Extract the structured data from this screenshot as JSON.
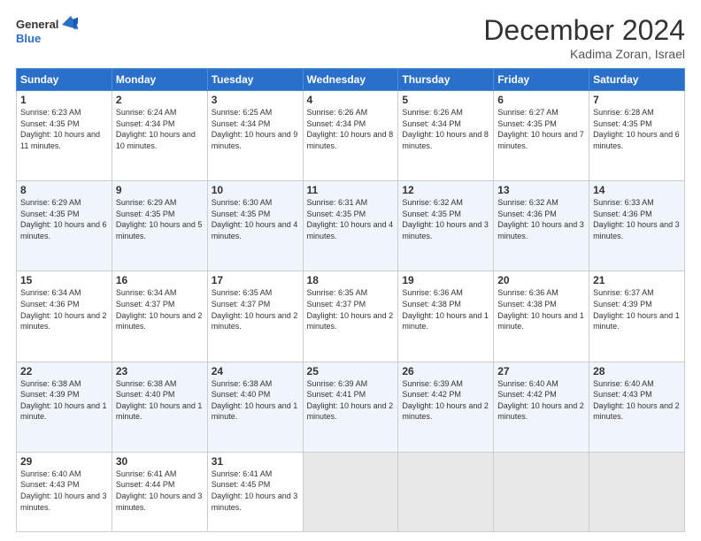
{
  "logo": {
    "general": "General",
    "blue": "Blue"
  },
  "title": "December 2024",
  "location": "Kadima Zoran, Israel",
  "header_days": [
    "Sunday",
    "Monday",
    "Tuesday",
    "Wednesday",
    "Thursday",
    "Friday",
    "Saturday"
  ],
  "weeks": [
    [
      {
        "day": "1",
        "info": "Sunrise: 6:23 AM\nSunset: 4:35 PM\nDaylight: 10 hours\nand 11 minutes."
      },
      {
        "day": "2",
        "info": "Sunrise: 6:24 AM\nSunset: 4:34 PM\nDaylight: 10 hours\nand 10 minutes."
      },
      {
        "day": "3",
        "info": "Sunrise: 6:25 AM\nSunset: 4:34 PM\nDaylight: 10 hours\nand 9 minutes."
      },
      {
        "day": "4",
        "info": "Sunrise: 6:26 AM\nSunset: 4:34 PM\nDaylight: 10 hours\nand 8 minutes."
      },
      {
        "day": "5",
        "info": "Sunrise: 6:26 AM\nSunset: 4:34 PM\nDaylight: 10 hours\nand 8 minutes."
      },
      {
        "day": "6",
        "info": "Sunrise: 6:27 AM\nSunset: 4:35 PM\nDaylight: 10 hours\nand 7 minutes."
      },
      {
        "day": "7",
        "info": "Sunrise: 6:28 AM\nSunset: 4:35 PM\nDaylight: 10 hours\nand 6 minutes."
      }
    ],
    [
      {
        "day": "8",
        "info": "Sunrise: 6:29 AM\nSunset: 4:35 PM\nDaylight: 10 hours\nand 6 minutes."
      },
      {
        "day": "9",
        "info": "Sunrise: 6:29 AM\nSunset: 4:35 PM\nDaylight: 10 hours\nand 5 minutes."
      },
      {
        "day": "10",
        "info": "Sunrise: 6:30 AM\nSunset: 4:35 PM\nDaylight: 10 hours\nand 4 minutes."
      },
      {
        "day": "11",
        "info": "Sunrise: 6:31 AM\nSunset: 4:35 PM\nDaylight: 10 hours\nand 4 minutes."
      },
      {
        "day": "12",
        "info": "Sunrise: 6:32 AM\nSunset: 4:35 PM\nDaylight: 10 hours\nand 3 minutes."
      },
      {
        "day": "13",
        "info": "Sunrise: 6:32 AM\nSunset: 4:36 PM\nDaylight: 10 hours\nand 3 minutes."
      },
      {
        "day": "14",
        "info": "Sunrise: 6:33 AM\nSunset: 4:36 PM\nDaylight: 10 hours\nand 3 minutes."
      }
    ],
    [
      {
        "day": "15",
        "info": "Sunrise: 6:34 AM\nSunset: 4:36 PM\nDaylight: 10 hours\nand 2 minutes."
      },
      {
        "day": "16",
        "info": "Sunrise: 6:34 AM\nSunset: 4:37 PM\nDaylight: 10 hours\nand 2 minutes."
      },
      {
        "day": "17",
        "info": "Sunrise: 6:35 AM\nSunset: 4:37 PM\nDaylight: 10 hours\nand 2 minutes."
      },
      {
        "day": "18",
        "info": "Sunrise: 6:35 AM\nSunset: 4:37 PM\nDaylight: 10 hours\nand 2 minutes."
      },
      {
        "day": "19",
        "info": "Sunrise: 6:36 AM\nSunset: 4:38 PM\nDaylight: 10 hours\nand 1 minute."
      },
      {
        "day": "20",
        "info": "Sunrise: 6:36 AM\nSunset: 4:38 PM\nDaylight: 10 hours\nand 1 minute."
      },
      {
        "day": "21",
        "info": "Sunrise: 6:37 AM\nSunset: 4:39 PM\nDaylight: 10 hours\nand 1 minute."
      }
    ],
    [
      {
        "day": "22",
        "info": "Sunrise: 6:38 AM\nSunset: 4:39 PM\nDaylight: 10 hours\nand 1 minute."
      },
      {
        "day": "23",
        "info": "Sunrise: 6:38 AM\nSunset: 4:40 PM\nDaylight: 10 hours\nand 1 minute."
      },
      {
        "day": "24",
        "info": "Sunrise: 6:38 AM\nSunset: 4:40 PM\nDaylight: 10 hours\nand 1 minute."
      },
      {
        "day": "25",
        "info": "Sunrise: 6:39 AM\nSunset: 4:41 PM\nDaylight: 10 hours\nand 2 minutes."
      },
      {
        "day": "26",
        "info": "Sunrise: 6:39 AM\nSunset: 4:42 PM\nDaylight: 10 hours\nand 2 minutes."
      },
      {
        "day": "27",
        "info": "Sunrise: 6:40 AM\nSunset: 4:42 PM\nDaylight: 10 hours\nand 2 minutes."
      },
      {
        "day": "28",
        "info": "Sunrise: 6:40 AM\nSunset: 4:43 PM\nDaylight: 10 hours\nand 2 minutes."
      }
    ],
    [
      {
        "day": "29",
        "info": "Sunrise: 6:40 AM\nSunset: 4:43 PM\nDaylight: 10 hours\nand 3 minutes."
      },
      {
        "day": "30",
        "info": "Sunrise: 6:41 AM\nSunset: 4:44 PM\nDaylight: 10 hours\nand 3 minutes."
      },
      {
        "day": "31",
        "info": "Sunrise: 6:41 AM\nSunset: 4:45 PM\nDaylight: 10 hours\nand 3 minutes."
      },
      {
        "day": "",
        "info": ""
      },
      {
        "day": "",
        "info": ""
      },
      {
        "day": "",
        "info": ""
      },
      {
        "day": "",
        "info": ""
      }
    ]
  ]
}
